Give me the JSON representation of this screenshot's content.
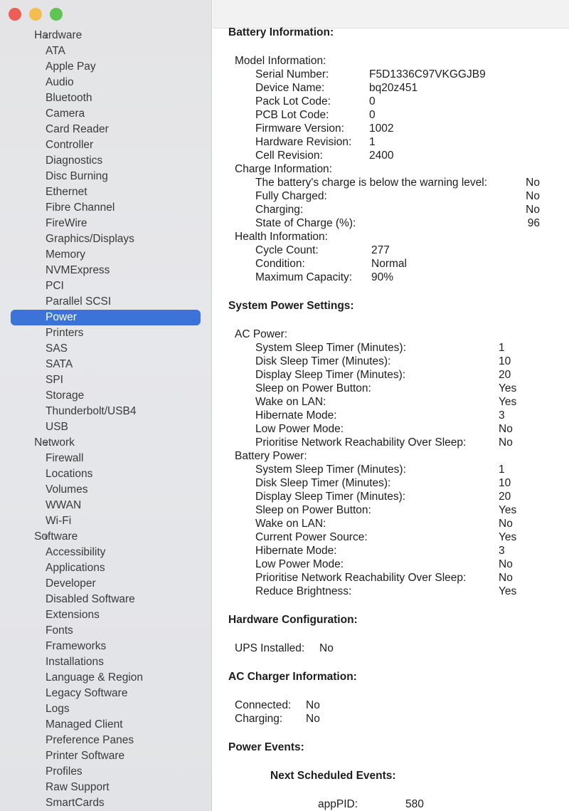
{
  "window": {
    "controls": [
      {
        "name": "close",
        "color": "#ec5f57"
      },
      {
        "name": "minimize",
        "color": "#f4bd4f"
      },
      {
        "name": "zoom",
        "color": "#5fc454"
      }
    ]
  },
  "sidebar": {
    "selected": "Power",
    "accent": "#3b73d9",
    "groups": [
      {
        "label": "Hardware",
        "items": [
          "ATA",
          "Apple Pay",
          "Audio",
          "Bluetooth",
          "Camera",
          "Card Reader",
          "Controller",
          "Diagnostics",
          "Disc Burning",
          "Ethernet",
          "Fibre Channel",
          "FireWire",
          "Graphics/Displays",
          "Memory",
          "NVMExpress",
          "PCI",
          "Parallel SCSI",
          "Power",
          "Printers",
          "SAS",
          "SATA",
          "SPI",
          "Storage",
          "Thunderbolt/USB4",
          "USB"
        ]
      },
      {
        "label": "Network",
        "items": [
          "Firewall",
          "Locations",
          "Volumes",
          "WWAN",
          "Wi-Fi"
        ]
      },
      {
        "label": "Software",
        "items": [
          "Accessibility",
          "Applications",
          "Developer",
          "Disabled Software",
          "Extensions",
          "Fonts",
          "Frameworks",
          "Installations",
          "Language & Region",
          "Legacy Software",
          "Logs",
          "Managed Client",
          "Preference Panes",
          "Printer Software",
          "Profiles",
          "Raw Support",
          "SmartCards"
        ]
      }
    ]
  },
  "content": {
    "battery_title": "Battery Information:",
    "model": {
      "label": "Model Information:",
      "rows": [
        [
          "Serial Number:",
          "F5D1336C97VKGGJB9"
        ],
        [
          "Device Name:",
          "bq20z451"
        ],
        [
          "Pack Lot Code:",
          "0"
        ],
        [
          "PCB Lot Code:",
          "0"
        ],
        [
          "Firmware Version:",
          "1002"
        ],
        [
          "Hardware Revision:",
          "1"
        ],
        [
          "Cell Revision:",
          "2400"
        ]
      ]
    },
    "charge": {
      "label": "Charge Information:",
      "rows": [
        [
          "The battery's charge is below the warning level:",
          "No"
        ],
        [
          "Fully Charged:",
          "No"
        ],
        [
          "Charging:",
          "No"
        ],
        [
          "State of Charge (%):",
          "96"
        ]
      ]
    },
    "health": {
      "label": "Health Information:",
      "rows": [
        [
          "Cycle Count:",
          "277"
        ],
        [
          "Condition:",
          "Normal"
        ],
        [
          "Maximum Capacity:",
          "90%"
        ]
      ]
    },
    "power_title": "System Power Settings:",
    "ac": {
      "label": "AC Power:",
      "rows": [
        [
          "System Sleep Timer (Minutes):",
          "1"
        ],
        [
          "Disk Sleep Timer (Minutes):",
          "10"
        ],
        [
          "Display Sleep Timer (Minutes):",
          "20"
        ],
        [
          "Sleep on Power Button:",
          "Yes"
        ],
        [
          "Wake on LAN:",
          "Yes"
        ],
        [
          "Hibernate Mode:",
          "3"
        ],
        [
          "Low Power Mode:",
          "No"
        ],
        [
          "Prioritise Network Reachability Over Sleep:",
          "No"
        ]
      ]
    },
    "battery": {
      "label": "Battery Power:",
      "rows": [
        [
          "System Sleep Timer (Minutes):",
          "1"
        ],
        [
          "Disk Sleep Timer (Minutes):",
          "10"
        ],
        [
          "Display Sleep Timer (Minutes):",
          "20"
        ],
        [
          "Sleep on Power Button:",
          "Yes"
        ],
        [
          "Wake on LAN:",
          "No"
        ],
        [
          "Current Power Source:",
          "Yes"
        ],
        [
          "Hibernate Mode:",
          "3"
        ],
        [
          "Low Power Mode:",
          "No"
        ],
        [
          "Prioritise Network Reachability Over Sleep:",
          "No"
        ],
        [
          "Reduce Brightness:",
          "Yes"
        ]
      ]
    },
    "hw_title": "Hardware Configuration:",
    "ups": {
      "rows": [
        [
          "UPS Installed:",
          "No"
        ]
      ]
    },
    "acc_title": "AC Charger Information:",
    "acc": {
      "rows": [
        [
          "Connected:",
          "No"
        ],
        [
          "Charging:",
          "No"
        ]
      ]
    },
    "events_title": "Power Events:",
    "next_title": "Next Scheduled Events:",
    "events": {
      "rows": [
        [
          "appPID:",
          "580"
        ]
      ]
    }
  }
}
